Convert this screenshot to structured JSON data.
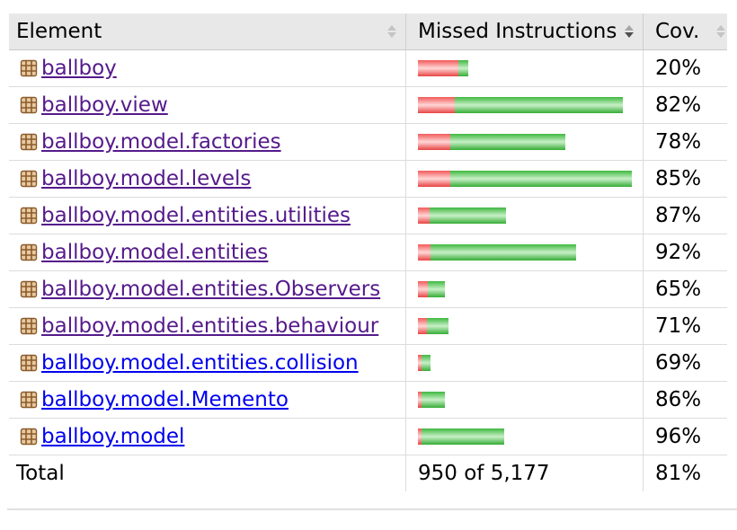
{
  "table": {
    "headers": {
      "element": "Element",
      "missed_instructions": "Missed Instructions",
      "coverage": "Cov."
    },
    "rows": [
      {
        "name": "ballboy",
        "coverage": "20%",
        "missed_ratio": 0.8,
        "bar_fraction": 0.234,
        "link_state": "visited"
      },
      {
        "name": "ballboy.view",
        "coverage": "82%",
        "missed_ratio": 0.18,
        "bar_fraction": 0.958,
        "link_state": "visited"
      },
      {
        "name": "ballboy.model.factories",
        "coverage": "78%",
        "missed_ratio": 0.22,
        "bar_fraction": 0.689,
        "link_state": "visited"
      },
      {
        "name": "ballboy.model.levels",
        "coverage": "85%",
        "missed_ratio": 0.15,
        "bar_fraction": 1.0,
        "link_state": "visited"
      },
      {
        "name": "ballboy.model.entities.utilities",
        "coverage": "87%",
        "missed_ratio": 0.13,
        "bar_fraction": 0.412,
        "link_state": "visited"
      },
      {
        "name": "ballboy.model.entities",
        "coverage": "92%",
        "missed_ratio": 0.08,
        "bar_fraction": 0.739,
        "link_state": "visited"
      },
      {
        "name": "ballboy.model.entities.Observers",
        "coverage": "65%",
        "missed_ratio": 0.35,
        "bar_fraction": 0.126,
        "link_state": "visited"
      },
      {
        "name": "ballboy.model.entities.behaviour",
        "coverage": "71%",
        "missed_ratio": 0.29,
        "bar_fraction": 0.143,
        "link_state": "visited"
      },
      {
        "name": "ballboy.model.entities.collision",
        "coverage": "69%",
        "missed_ratio": 0.31,
        "bar_fraction": 0.059,
        "link_state": "unvisited"
      },
      {
        "name": "ballboy.model.Memento",
        "coverage": "86%",
        "missed_ratio": 0.14,
        "bar_fraction": 0.126,
        "link_state": "unvisited"
      },
      {
        "name": "ballboy.model",
        "coverage": "96%",
        "missed_ratio": 0.04,
        "bar_fraction": 0.403,
        "link_state": "unvisited"
      }
    ],
    "total": {
      "label": "Total",
      "missed_instructions": "950 of 5,177",
      "coverage": "81%"
    }
  },
  "colors": {
    "missed": "#f25a5a",
    "covered": "#3fb83f",
    "header_bg": "#e8e8e8",
    "visited_link": "#551a8b",
    "unvisited_link": "#0000ee"
  },
  "icons": {
    "package": "package-icon",
    "sort": "sort-icon"
  }
}
